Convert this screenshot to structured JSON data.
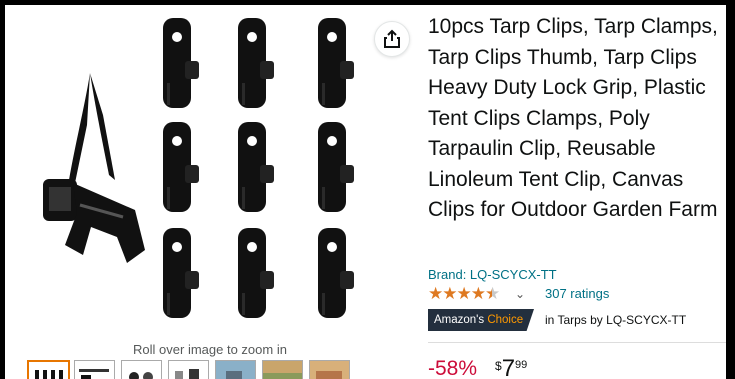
{
  "product": {
    "title": "10pcs Tarp Clips, Tarp Clamps, Tarp Clips Thumb, Tarp Clips Heavy Duty Lock Grip, Plastic Tent Clips Clamps, Poly Tarpaulin Clip, Reusable Linoleum Tent Clip, Canvas Clips for Outdoor Garden Farm",
    "brand_link": "Brand: LQ-SCYCX-TT",
    "rating_stars": 4.5,
    "ratings_text": "307 ratings",
    "badge": {
      "prefix": "Amazon's ",
      "accent": "Choice"
    },
    "choice_category": "in Tarps by LQ-SCYCX-TT",
    "discount": "-58%",
    "price": {
      "symbol": "$",
      "whole": "7",
      "fraction": "99"
    }
  },
  "gallery": {
    "zoom_hint": "Roll over image to zoom in",
    "thumbnail_count": 7,
    "active_thumbnail": 1
  },
  "colors": {
    "price_red": "#cc0c39",
    "link_teal": "#007185",
    "star_orange": "#de7921",
    "badge_navy": "#232f3e",
    "badge_accent": "#ff9900",
    "thumb_active": "#e77600"
  },
  "icons": {
    "share": "share-icon",
    "star": "star-icon",
    "caret": "chevron-down-icon"
  }
}
